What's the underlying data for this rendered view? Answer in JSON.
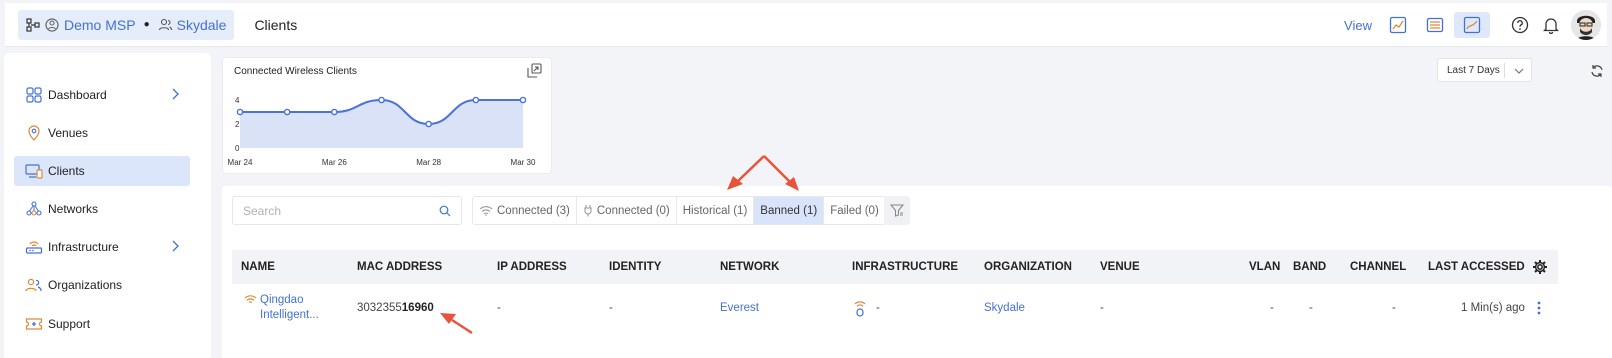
{
  "header": {
    "org_label": "Demo MSP",
    "site_label": "Skydale",
    "page_title": "Clients",
    "view_label": "View"
  },
  "sidebar": {
    "items": [
      {
        "label": "Dashboard",
        "has_chevron": true
      },
      {
        "label": "Venues"
      },
      {
        "label": "Clients",
        "active": true
      },
      {
        "label": "Networks"
      },
      {
        "label": "Infrastructure",
        "has_chevron": true
      },
      {
        "label": "Organizations"
      },
      {
        "label": "Support"
      }
    ]
  },
  "chart_card": {
    "title": "Connected Wireless Clients"
  },
  "chart_data": {
    "type": "area",
    "title": "Connected Wireless Clients",
    "x_tick_labels": [
      "Mar 24",
      "Mar 26",
      "Mar 28",
      "Mar 30"
    ],
    "y_tick_labels": [
      "0",
      "2",
      "4"
    ],
    "ylim": [
      0,
      4
    ],
    "x": [
      "Mar 24",
      "Mar 25",
      "Mar 26",
      "Mar 27",
      "Mar 28",
      "Mar 29",
      "Mar 30"
    ],
    "values": [
      3,
      3,
      3,
      4,
      2,
      4,
      4
    ],
    "color": "#4a72d8",
    "fill": "#d9e2f6"
  },
  "date_range": {
    "selected": "Last 7 Days"
  },
  "search": {
    "placeholder": "Search"
  },
  "tabs": [
    {
      "label": "Connected (3)",
      "icon": "wifi-icon"
    },
    {
      "label": "Connected (0)",
      "icon": "plug-icon"
    },
    {
      "label": "Historical (1)"
    },
    {
      "label": "Banned (1)",
      "active": true
    },
    {
      "label": "Failed (0)"
    }
  ],
  "table": {
    "columns": [
      "NAME",
      "MAC ADDRESS",
      "IP ADDRESS",
      "IDENTITY",
      "NETWORK",
      "INFRASTRUCTURE",
      "ORGANIZATION",
      "VENUE",
      "VLAN",
      "BAND",
      "CHANNEL",
      "LAST ACCESSED"
    ],
    "rows": [
      {
        "name_line1": "Qingdao",
        "name_line2": "Intelligent...",
        "mac_prefix": "3032355",
        "mac_suffix": "16960",
        "ip": "-",
        "identity": "-",
        "network": "Everest",
        "infrastructure": "-",
        "organization": "Skydale",
        "venue": "-",
        "vlan": "-",
        "band": "-",
        "channel": "-",
        "last_accessed": "1 Min(s) ago"
      }
    ]
  },
  "colors": {
    "accent": "#4470d6",
    "active_bg": "#dce6fb",
    "annotation_arrow": "#e8543a"
  }
}
